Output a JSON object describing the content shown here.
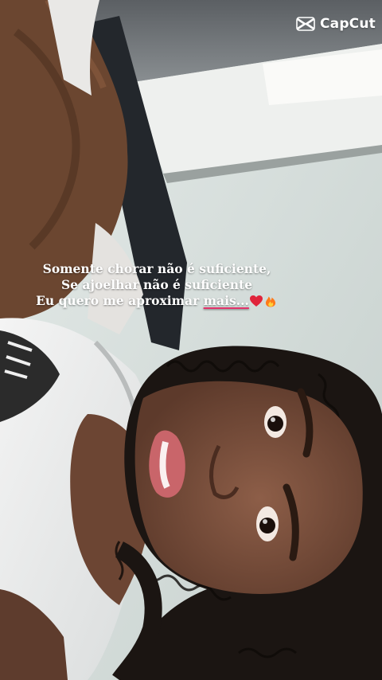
{
  "watermark": {
    "brand": "CapCut",
    "icon": "capcut-logo-icon"
  },
  "caption": {
    "line1": "Somente chorar não é suficiente,",
    "line2": "Se ajoelhar não é suficiente",
    "line3_prefix": "Eu quero me aproximar ",
    "line3_highlight": "mais...",
    "emoji1": "heart-icon",
    "emoji2": "fire-icon",
    "underline_color": "#e3336b"
  },
  "colors": {
    "wall": "#cfd6d4",
    "shirt": "#efefef",
    "hair": "#1b1512",
    "skin": "#7a4f3c",
    "blanket": "#6b4630",
    "accent": "#e3336b"
  }
}
